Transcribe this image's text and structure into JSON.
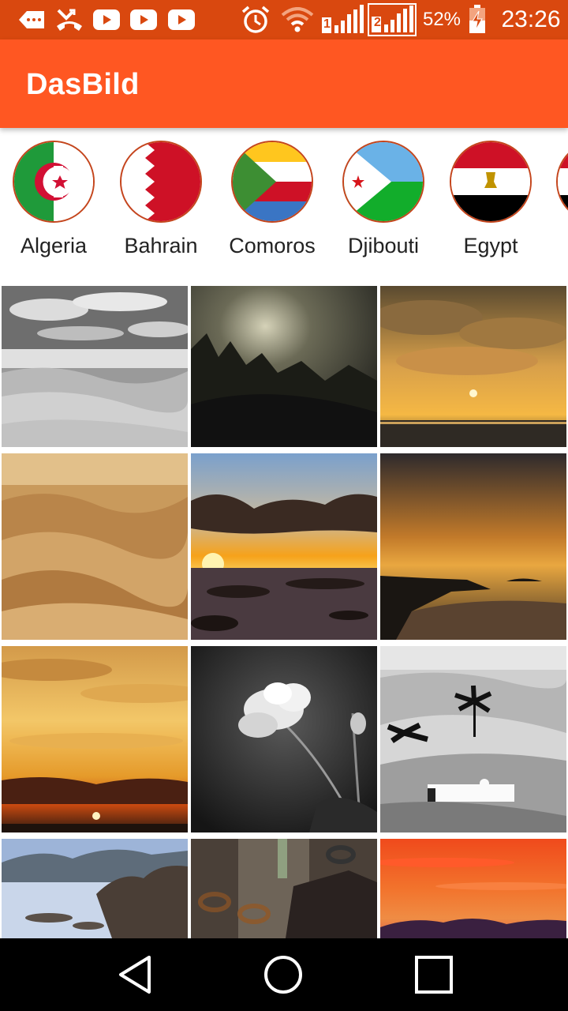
{
  "status_bar": {
    "battery_percent": "52%",
    "time": "23:26",
    "sim1_label": "1",
    "sim2_label": "2",
    "icons": [
      "notification-icon",
      "missed-call-icon",
      "youtube-icon",
      "youtube-icon",
      "youtube-icon",
      "alarm-icon",
      "wifi-icon",
      "signal-sim1-icon",
      "signal-sim2-icon",
      "battery-charging-icon"
    ]
  },
  "app_bar": {
    "title": "DasBild"
  },
  "countries": [
    {
      "name": "Algeria"
    },
    {
      "name": "Bahrain"
    },
    {
      "name": "Comoros"
    },
    {
      "name": "Djibouti"
    },
    {
      "name": "Egypt"
    }
  ],
  "photos": [
    {
      "subject": "desert-grayscale"
    },
    {
      "subject": "dark-silhouette-plants"
    },
    {
      "subject": "sunset-sea-clouds"
    },
    {
      "subject": "sand-dunes"
    },
    {
      "subject": "sunset-rocky-shore"
    },
    {
      "subject": "sunset-coastline"
    },
    {
      "subject": "golden-sunset-sky"
    },
    {
      "subject": "white-rose-bw"
    },
    {
      "subject": "desert-palms-bw"
    },
    {
      "subject": "rocky-sea-coast"
    },
    {
      "subject": "rusty-chain"
    },
    {
      "subject": "red-sky-mountains"
    }
  ],
  "colors": {
    "status_bar": "#d9480f",
    "app_bar": "#ff5722",
    "flag_border": "#c4451c"
  },
  "nav_bar": {
    "buttons": [
      "back-icon",
      "home-icon",
      "recents-icon"
    ]
  }
}
